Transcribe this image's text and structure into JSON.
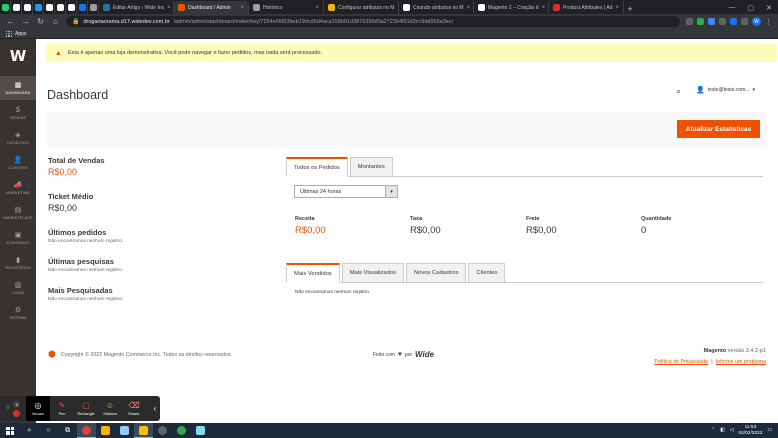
{
  "browser": {
    "tabs": [
      {
        "label": "",
        "color": "#25d366"
      },
      {
        "label": "",
        "color": "#ffffff"
      },
      {
        "label": "",
        "color": "#ffffff"
      },
      {
        "label": "",
        "color": "#2196f3"
      },
      {
        "label": "",
        "color": "#ffffff"
      },
      {
        "label": "",
        "color": "#ffffff"
      },
      {
        "label": "",
        "color": "#ffffff"
      },
      {
        "label": "",
        "color": "#1a73e8"
      },
      {
        "label": "",
        "color": "#9e9e9e"
      },
      {
        "label": "Editar Artigo ‹ Wide Ins",
        "color": "#21759b"
      },
      {
        "label": "Dashboard / Admin",
        "color": "#eb5202",
        "active": true
      },
      {
        "label": "Histórico",
        "color": "#9aa0a6"
      },
      {
        "label": "Configurar atributos no M",
        "color": "#f4b400"
      },
      {
        "label": "Criando atributos no M",
        "color": "#ffffff"
      },
      {
        "label": "Magento 2 – Criação d",
        "color": "#ffffff"
      },
      {
        "label": "Product Attributes | Ad",
        "color": "#d93025"
      }
    ],
    "new_tab": "+",
    "url_host": "drogariaorama.d17.widedev.com.br",
    "url_path": "/admin/admin/dashboard/index/key/7254e66f53beb19dcd5d4aca158b01d3876390d0a272394f91d2cc9dd956a3ec/",
    "bookmarks_label": "Apps",
    "profile_initial": "W"
  },
  "sidebar": {
    "logo": "W",
    "items": [
      {
        "label": "Dashboard",
        "icon": "▦",
        "active": true
      },
      {
        "label": "Vendas",
        "icon": "$"
      },
      {
        "label": "Catálogo",
        "icon": "◈"
      },
      {
        "label": "Clientes",
        "icon": "👤"
      },
      {
        "label": "Marketing",
        "icon": "📣"
      },
      {
        "label": "Marketplace",
        "icon": "▤"
      },
      {
        "label": "Conteúdo",
        "icon": "▣"
      },
      {
        "label": "Relatórios",
        "icon": "▮"
      },
      {
        "label": "Lojas",
        "icon": "▥"
      },
      {
        "label": "Sistema",
        "icon": "⚙"
      }
    ]
  },
  "notice": {
    "text": "Esta é apenas uma loja demonstrativa. Você pode navegar e fazer pedidos, mas nada será processado."
  },
  "header": {
    "title": "Dashboard",
    "user": "teste@teste.com..."
  },
  "actions": {
    "refresh_label": "Atualizar Estatísticas"
  },
  "stats": {
    "total_vendas": {
      "label": "Total de Vendas",
      "value": "R$0,00"
    },
    "ticket_medio": {
      "label": "Ticket Médio",
      "value": "R$0,00"
    },
    "ultimos_pedidos": {
      "label": "Últimos pedidos",
      "empty": "Não encontramos nenhum registro."
    },
    "ultimas_pesquisas": {
      "label": "Últimas pesquisas",
      "empty": "Não encontramos nenhum registro."
    },
    "mais_pesquisadas": {
      "label": "Mais Pesquisadas",
      "empty": "Não encontramos nenhum registro."
    }
  },
  "chart_tabs": [
    "Todos os Pedidos",
    "Montantes"
  ],
  "period_select": {
    "value": "Últimas 24 horas"
  },
  "metrics": [
    {
      "label": "Receita",
      "value": "R$0,00",
      "highlight": true
    },
    {
      "label": "Taxa",
      "value": "R$0,00"
    },
    {
      "label": "Frete",
      "value": "R$0,00"
    },
    {
      "label": "Quantidade",
      "value": "0"
    }
  ],
  "grid_tabs": [
    "Mais Vendidos",
    "Mais Visualizados",
    "Novos Cadastros",
    "Clientes"
  ],
  "grid_empty": "Não encontramos nenhum registro.",
  "footer": {
    "copyright": "Copyright © 2022 Magento Commerce Inc. Todos os direitos reservados.",
    "made_by_prefix": "Feito com",
    "made_by_by": "por",
    "made_by_brand": "Wide",
    "version_label": "Magento",
    "version": "versão 2.4.2-p1",
    "privacy": "Política de Privacidade",
    "separator": "|",
    "report": "Informe um problema"
  },
  "recorder": {
    "tools": [
      {
        "label": "Mouse",
        "icon": "◎",
        "active": true
      },
      {
        "label": "Pen",
        "icon": "✎",
        "color": "#ff4444"
      },
      {
        "label": "Rectangle",
        "icon": "▢",
        "color": "#ff4444"
      },
      {
        "label": "Stickers",
        "icon": "☺",
        "color": "#fbbc04"
      },
      {
        "label": "Eraser",
        "icon": "⌫",
        "color": "#ff8a80"
      }
    ],
    "pause": "II"
  },
  "taskbar": {
    "time": "11:53",
    "date": "04/02/2022"
  },
  "colors": {
    "accent": "#eb5202",
    "sidebar": "#373330",
    "notice": "#fffbbb"
  }
}
